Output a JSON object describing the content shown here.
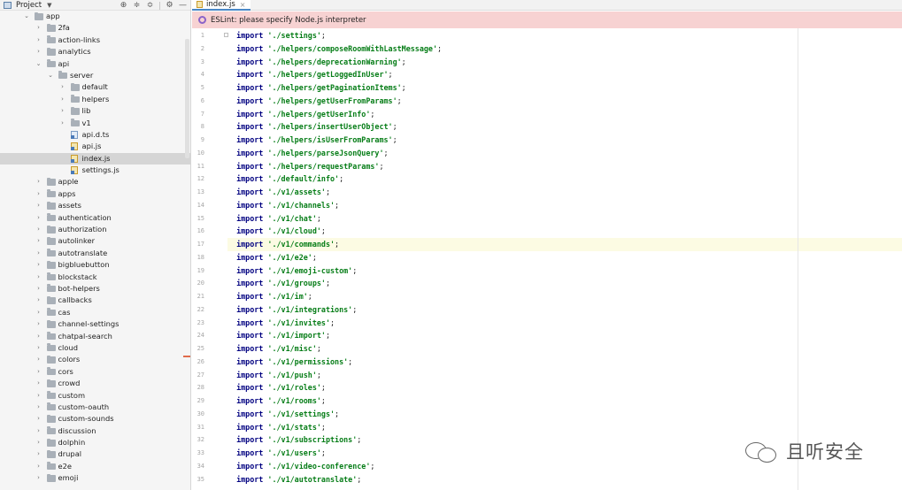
{
  "panel": {
    "title": "Project",
    "tools": [
      "target-icon",
      "collapse-all-icon",
      "expand-icon",
      "gear-icon",
      "minimize-icon"
    ]
  },
  "tree": [
    {
      "label": "app",
      "depth": 0,
      "type": "folder",
      "expanded": true
    },
    {
      "label": "2fa",
      "depth": 1,
      "type": "folder",
      "expanded": false
    },
    {
      "label": "action-links",
      "depth": 1,
      "type": "folder",
      "expanded": false
    },
    {
      "label": "analytics",
      "depth": 1,
      "type": "folder",
      "expanded": false
    },
    {
      "label": "api",
      "depth": 1,
      "type": "folder",
      "expanded": true
    },
    {
      "label": "server",
      "depth": 2,
      "type": "folder",
      "expanded": true
    },
    {
      "label": "default",
      "depth": 3,
      "type": "folder",
      "expanded": false
    },
    {
      "label": "helpers",
      "depth": 3,
      "type": "folder",
      "expanded": false
    },
    {
      "label": "lib",
      "depth": 3,
      "type": "folder",
      "expanded": false
    },
    {
      "label": "v1",
      "depth": 3,
      "type": "folder",
      "expanded": false
    },
    {
      "label": "api.d.ts",
      "depth": 3,
      "type": "ts"
    },
    {
      "label": "api.js",
      "depth": 3,
      "type": "js"
    },
    {
      "label": "index.js",
      "depth": 3,
      "type": "js",
      "selected": true
    },
    {
      "label": "settings.js",
      "depth": 3,
      "type": "js"
    },
    {
      "label": "apple",
      "depth": 1,
      "type": "folder",
      "expanded": false
    },
    {
      "label": "apps",
      "depth": 1,
      "type": "folder",
      "expanded": false
    },
    {
      "label": "assets",
      "depth": 1,
      "type": "folder",
      "expanded": false
    },
    {
      "label": "authentication",
      "depth": 1,
      "type": "folder",
      "expanded": false
    },
    {
      "label": "authorization",
      "depth": 1,
      "type": "folder",
      "expanded": false
    },
    {
      "label": "autolinker",
      "depth": 1,
      "type": "folder",
      "expanded": false
    },
    {
      "label": "autotranslate",
      "depth": 1,
      "type": "folder",
      "expanded": false
    },
    {
      "label": "bigbluebutton",
      "depth": 1,
      "type": "folder",
      "expanded": false
    },
    {
      "label": "blockstack",
      "depth": 1,
      "type": "folder",
      "expanded": false
    },
    {
      "label": "bot-helpers",
      "depth": 1,
      "type": "folder",
      "expanded": false
    },
    {
      "label": "callbacks",
      "depth": 1,
      "type": "folder",
      "expanded": false
    },
    {
      "label": "cas",
      "depth": 1,
      "type": "folder",
      "expanded": false
    },
    {
      "label": "channel-settings",
      "depth": 1,
      "type": "folder",
      "expanded": false
    },
    {
      "label": "chatpal-search",
      "depth": 1,
      "type": "folder",
      "expanded": false
    },
    {
      "label": "cloud",
      "depth": 1,
      "type": "folder",
      "expanded": false
    },
    {
      "label": "colors",
      "depth": 1,
      "type": "folder",
      "expanded": false
    },
    {
      "label": "cors",
      "depth": 1,
      "type": "folder",
      "expanded": false
    },
    {
      "label": "crowd",
      "depth": 1,
      "type": "folder",
      "expanded": false
    },
    {
      "label": "custom",
      "depth": 1,
      "type": "folder",
      "expanded": false
    },
    {
      "label": "custom-oauth",
      "depth": 1,
      "type": "folder",
      "expanded": false
    },
    {
      "label": "custom-sounds",
      "depth": 1,
      "type": "folder",
      "expanded": false
    },
    {
      "label": "discussion",
      "depth": 1,
      "type": "folder",
      "expanded": false
    },
    {
      "label": "dolphin",
      "depth": 1,
      "type": "folder",
      "expanded": false
    },
    {
      "label": "drupal",
      "depth": 1,
      "type": "folder",
      "expanded": false
    },
    {
      "label": "e2e",
      "depth": 1,
      "type": "folder",
      "expanded": false
    },
    {
      "label": "emoji",
      "depth": 1,
      "type": "folder",
      "expanded": false
    }
  ],
  "editor": {
    "tab_label": "index.js",
    "tab_close": "×",
    "banner_text": "ESLint: please specify Node.js interpreter",
    "current_line": 17,
    "keyword": "import",
    "lines": [
      "'./settings'",
      "'./helpers/composeRoomWithLastMessage'",
      "'./helpers/deprecationWarning'",
      "'./helpers/getLoggedInUser'",
      "'./helpers/getPaginationItems'",
      "'./helpers/getUserFromParams'",
      "'./helpers/getUserInfo'",
      "'./helpers/insertUserObject'",
      "'./helpers/isUserFromParams'",
      "'./helpers/parseJsonQuery'",
      "'./helpers/requestParams'",
      "'./default/info'",
      "'./v1/assets'",
      "'./v1/channels'",
      "'./v1/chat'",
      "'./v1/cloud'",
      "'./v1/commands'",
      "'./v1/e2e'",
      "'./v1/emoji-custom'",
      "'./v1/groups'",
      "'./v1/im'",
      "'./v1/integrations'",
      "'./v1/invites'",
      "'./v1/import'",
      "'./v1/misc'",
      "'./v1/permissions'",
      "'./v1/push'",
      "'./v1/roles'",
      "'./v1/rooms'",
      "'./v1/settings'",
      "'./v1/stats'",
      "'./v1/subscriptions'",
      "'./v1/users'",
      "'./v1/video-conference'",
      "'./v1/autotranslate'"
    ]
  },
  "watermark": {
    "text": "且听安全"
  }
}
